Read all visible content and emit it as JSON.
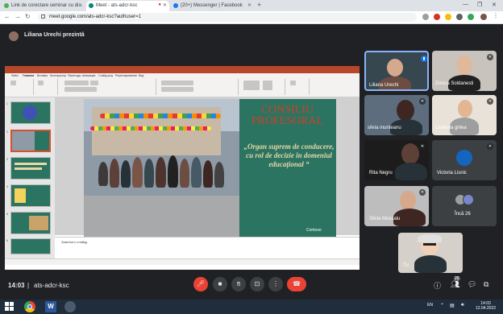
{
  "browser": {
    "tabs": [
      {
        "title": "Link de corectare seminar cu di..."
      },
      {
        "title": "Meet - ats-adcr-ksc"
      },
      {
        "title": "(20+) Messenger | Facebook"
      }
    ],
    "new_tab_glyph": "+",
    "url": "meet.google.com/ats-adcr-ksc?authuser=1",
    "colors": {
      "tabbar": "#dee1e6",
      "meet_bg": "#202124"
    }
  },
  "meet": {
    "presenter_text": "Liliana Urechi prezintă",
    "meeting_time": "14:03",
    "meeting_code": "ats-adcr-ksc",
    "participants": [
      {
        "name": "Liliana Urechi",
        "speaking": true
      },
      {
        "name": "Dinora Soldanesti"
      },
      {
        "name": "silvia munteanu"
      },
      {
        "name": "Liudmila girlea"
      },
      {
        "name": "Rita Negru"
      },
      {
        "name": "Victoria Lisnic"
      },
      {
        "name": "Silvia Moscalu"
      },
      {
        "name": "Încă 26"
      },
      {
        "name": "Tu"
      }
    ],
    "people_count": "26",
    "end_call_color": "#ea4335"
  },
  "ppt": {
    "ribbon_tabs": [
      "Файл",
      "Главная",
      "Вставка",
      "Конструктор",
      "Переходы",
      "Анимация",
      "Слайд-шоу",
      "Рецензирование",
      "Вид"
    ],
    "slide_numbers": [
      "1",
      "2",
      "3",
      "4",
      "5",
      "6"
    ],
    "slide_title": "CONSILIU PROFESORAL",
    "slide_quote": "„Organ suprem de conducere, cu rol de decizie în domeniul educațional “",
    "slide_logo": "Contoso",
    "notes_placeholder": "Заметки к слайду"
  },
  "taskbar": {
    "lang": "EN",
    "time": "14:03",
    "date": "12.04.2022"
  }
}
